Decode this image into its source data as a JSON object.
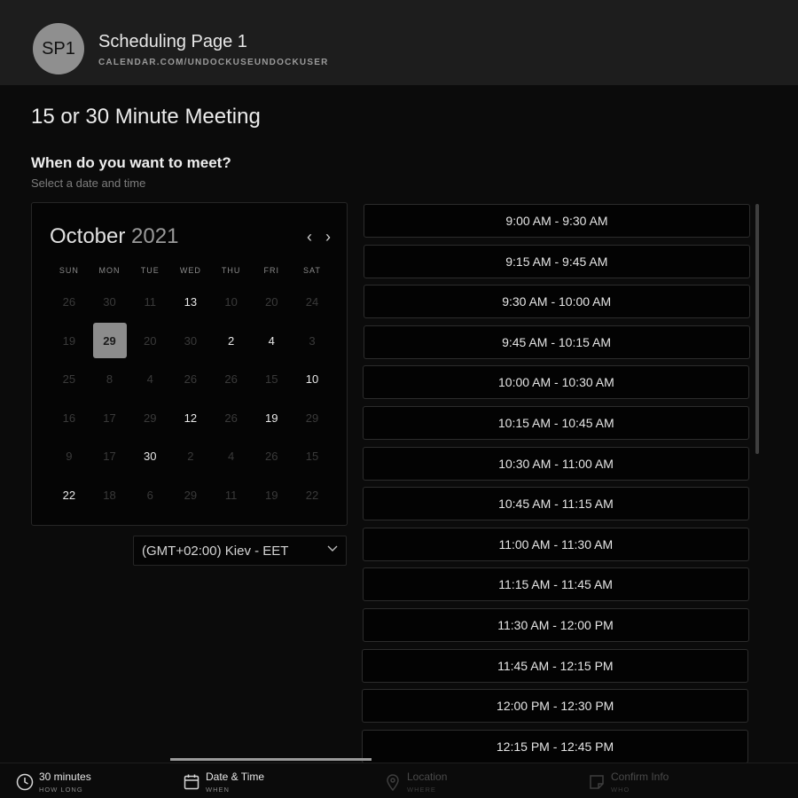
{
  "header": {
    "avatar_initials": "SP1",
    "page_name": "Scheduling Page 1",
    "page_url": "CALENDAR.COM/UNDOCKUSEUNDOCKUSER"
  },
  "meeting": {
    "title": "15 or 30 Minute Meeting",
    "question": "When do you want to meet?",
    "question_sub": "Select a date and time"
  },
  "calendar": {
    "month": "October",
    "year": "2021",
    "prev_icon": "chevron-left-icon",
    "next_icon": "chevron-right-icon",
    "weekdays": [
      "SUN",
      "MON",
      "TUE",
      "WED",
      "THU",
      "FRI",
      "SAT"
    ],
    "days": [
      {
        "label": "26",
        "available": false
      },
      {
        "label": "30",
        "available": false
      },
      {
        "label": "11",
        "available": false
      },
      {
        "label": "13",
        "available": true
      },
      {
        "label": "10",
        "available": false
      },
      {
        "label": "20",
        "available": false
      },
      {
        "label": "24",
        "available": false
      },
      {
        "label": "19",
        "available": false
      },
      {
        "label": "29",
        "available": true,
        "selected": true
      },
      {
        "label": "20",
        "available": false
      },
      {
        "label": "30",
        "available": false
      },
      {
        "label": "2",
        "available": true
      },
      {
        "label": "4",
        "available": true
      },
      {
        "label": "3",
        "available": false
      },
      {
        "label": "25",
        "available": false
      },
      {
        "label": "8",
        "available": false
      },
      {
        "label": "4",
        "available": false
      },
      {
        "label": "26",
        "available": false
      },
      {
        "label": "26",
        "available": false
      },
      {
        "label": "15",
        "available": false
      },
      {
        "label": "10",
        "available": true
      },
      {
        "label": "16",
        "available": false
      },
      {
        "label": "17",
        "available": false
      },
      {
        "label": "29",
        "available": false
      },
      {
        "label": "12",
        "available": true
      },
      {
        "label": "26",
        "available": false
      },
      {
        "label": "19",
        "available": true
      },
      {
        "label": "29",
        "available": false
      },
      {
        "label": "9",
        "available": false
      },
      {
        "label": "17",
        "available": false
      },
      {
        "label": "30",
        "available": true
      },
      {
        "label": "2",
        "available": false
      },
      {
        "label": "4",
        "available": false
      },
      {
        "label": "26",
        "available": false
      },
      {
        "label": "15",
        "available": false
      },
      {
        "label": "22",
        "available": true
      },
      {
        "label": "18",
        "available": false
      },
      {
        "label": "6",
        "available": false
      },
      {
        "label": "29",
        "available": false
      },
      {
        "label": "11",
        "available": false
      },
      {
        "label": "19",
        "available": false
      },
      {
        "label": "22",
        "available": false
      }
    ]
  },
  "timezone": {
    "value": "(GMT+02:00) Kiev - EET",
    "chevron_icon": "chevron-down-icon"
  },
  "slots": [
    "9:00 AM - 9:30 AM",
    "9:15 AM - 9:45 AM",
    "9:30 AM - 10:00 AM",
    "9:45 AM - 10:15 AM",
    "10:00 AM - 10:30 AM",
    "10:15 AM - 10:45 AM",
    "10:30 AM - 11:00 AM",
    "10:45 AM - 11:15 AM",
    "11:00 AM - 11:30 AM",
    "11:15 AM - 11:45 AM",
    "11:30 AM - 12:00 PM",
    "11:45 AM - 12:15 PM",
    "12:00 PM - 12:30 PM",
    "12:15 PM - 12:45 PM"
  ],
  "footer": {
    "steps": [
      {
        "label": "30 minutes",
        "sub": "HOW LONG",
        "icon": "clock-icon",
        "active": true
      },
      {
        "label": "Date & Time",
        "sub": "WHEN",
        "icon": "calendar-icon",
        "active": true
      },
      {
        "label": "Location",
        "sub": "WHERE",
        "icon": "location-pin-icon",
        "active": false
      },
      {
        "label": "Confirm Info",
        "sub": "WHO",
        "icon": "note-icon",
        "active": false
      }
    ]
  }
}
